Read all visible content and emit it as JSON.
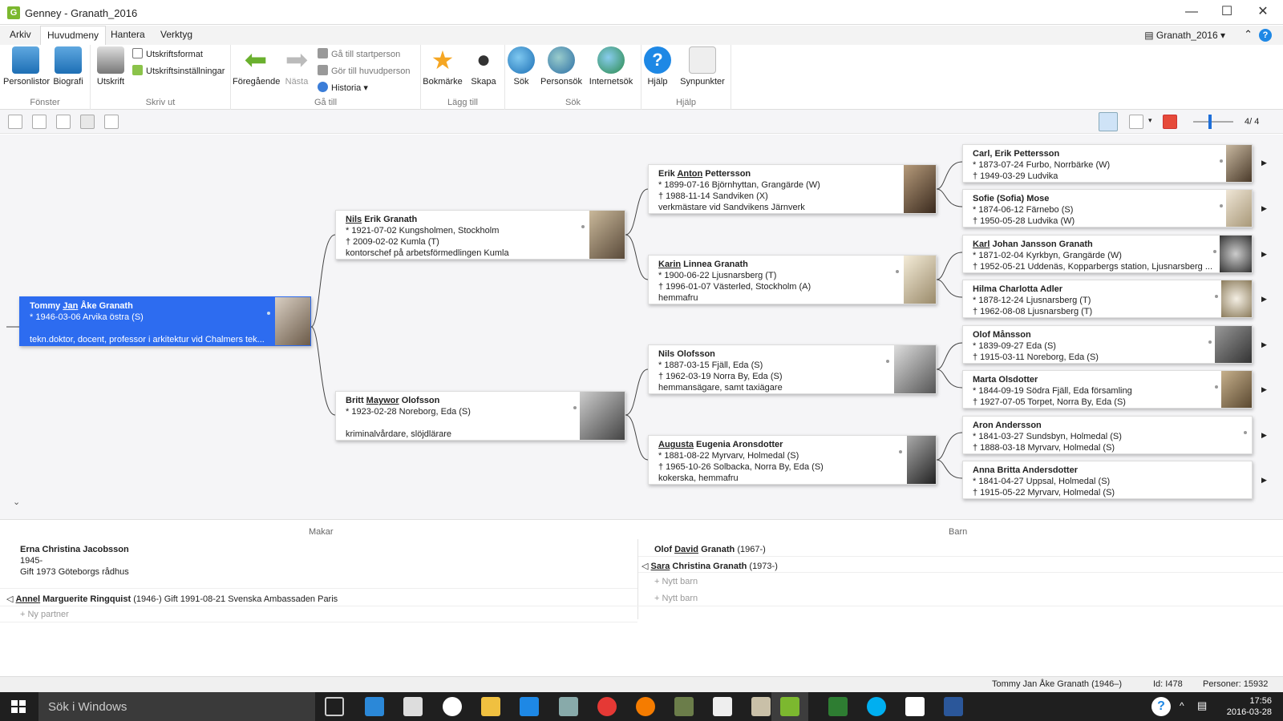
{
  "window": {
    "title": "Genney - Granath_2016",
    "logo": "G"
  },
  "menu": {
    "items": [
      "Arkiv",
      "Huvudmeny",
      "Hantera",
      "Verktyg"
    ],
    "active": "Huvudmeny",
    "project": "Granath_2016"
  },
  "ribbon": {
    "fonster": {
      "label": "Fönster",
      "personlistor": "Personlistor",
      "biografi": "Biografi"
    },
    "skrivut": {
      "label": "Skriv ut",
      "utskrift": "Utskrift",
      "format": "Utskriftsformat",
      "installningar": "Utskriftsinställningar"
    },
    "gatill": {
      "label": "Gå till",
      "foregaende": "Föregående",
      "nasta": "Nästa",
      "startperson": "Gå till startperson",
      "huvudperson": "Gör till huvudperson",
      "historia": "Historia"
    },
    "laggtill": {
      "label": "Lägg till",
      "bokmarke": "Bokmärke",
      "skapa": "Skapa"
    },
    "sok": {
      "label": "Sök",
      "sok": "Sök",
      "personsok": "Personsök",
      "internetsok": "Internetsök"
    },
    "hjalp": {
      "label": "Hjälp",
      "hjalp": "Hjälp",
      "synpunkter": "Synpunkter"
    }
  },
  "toolbar2": {
    "generations": "4/  4"
  },
  "tree": {
    "root": {
      "pre": "Tommy ",
      "u": "Jan",
      "post": " Åke Granath",
      "l1": "* 1946-03-06 Arvika östra (S)",
      "l2": "",
      "l3": "tekn.doktor, docent, professor i arkitektur vid Chalmers tek..."
    },
    "father": {
      "pre": "",
      "u": "Nils",
      "post": " Erik Granath",
      "l1": "* 1921-07-02 Kungsholmen, Stockholm",
      "l2": "† 2009-02-02 Kumla (T)",
      "l3": "kontorschef på arbetsförmedlingen Kumla"
    },
    "mother": {
      "pre": "Britt ",
      "u": "Maywor",
      "post": " Olofsson",
      "l1": "* 1923-02-28 Noreborg, Eda (S)",
      "l2": "",
      "l3": "kriminalvårdare, slöjdlärare"
    },
    "ff": {
      "pre": "Erik ",
      "u": "Anton",
      "post": " Pettersson",
      "l1": "* 1899-07-16 Björnhyttan, Grangärde (W)",
      "l2": "† 1988-11-14 Sandviken (X)",
      "l3": "verkmästare vid Sandvikens Järnverk"
    },
    "fm": {
      "pre": "",
      "u": "Karin",
      "post": " Linnea Granath",
      "l1": "* 1900-06-22 Ljusnarsberg (T)",
      "l2": "† 1996-01-07 Västerled, Stockholm (A)",
      "l3": "hemmafru"
    },
    "mf": {
      "pre": "Nils Olofsson",
      "u": "",
      "post": "",
      "l1": "* 1887-03-15 Fjäll, Eda (S)",
      "l2": "† 1962-03-19 Norra By, Eda (S)",
      "l3": "hemmansägare, samt taxiägare"
    },
    "mm": {
      "pre": "",
      "u": "Augusta",
      "post": " Eugenia Aronsdotter",
      "l1": "* 1881-08-22 Myrvarv, Holmedal (S)",
      "l2": "† 1965-10-26 Solbacka, Norra By, Eda (S)",
      "l3": "kokerska, hemmafru"
    },
    "g1": {
      "pre": "Carl, Erik Pettersson",
      "u": "",
      "post": "",
      "l1": "* 1873-07-24 Furbo, Norrbärke (W)",
      "l2": "† 1949-03-29 Ludvika"
    },
    "g2": {
      "pre": "Sofie (Sofia) Mose",
      "u": "",
      "post": "",
      "l1": "* 1874-06-12 Färnebo (S)",
      "l2": "† 1950-05-28 Ludvika (W)"
    },
    "g3": {
      "pre": "",
      "u": "Karl",
      "post": " Johan Jansson Granath",
      "l1": "* 1871-02-04 Kyrkbyn, Grangärde (W)",
      "l2": "† 1952-05-21 Uddenäs, Kopparbergs station, Ljusnarsberg ..."
    },
    "g4": {
      "pre": "Hilma Charlotta Adler",
      "u": "",
      "post": "",
      "l1": "* 1878-12-24 Ljusnarsberg (T)",
      "l2": "† 1962-08-08 Ljusnarsberg (T)"
    },
    "g5": {
      "pre": "Olof Månsson",
      "u": "",
      "post": "",
      "l1": "* 1839-09-27 Eda (S)",
      "l2": "† 1915-03-11 Noreborg, Eda (S)"
    },
    "g6": {
      "pre": "Marta Olsdotter",
      "u": "",
      "post": "",
      "l1": "* 1844-09-19 Södra Fjäll, Eda församling",
      "l2": "† 1927-07-05 Torpet, Norra By, Eda (S)"
    },
    "g7": {
      "pre": "Aron Andersson",
      "u": "",
      "post": "",
      "l1": "* 1841-03-27 Sundsbyn, Holmedal (S)",
      "l2": "† 1888-03-18 Myrvarv, Holmedal (S)"
    },
    "g8": {
      "pre": "Anna Britta Andersdotter",
      "u": "",
      "post": "",
      "l1": "* 1841-04-27 Uppsal, Holmedal (S)",
      "l2": "† 1915-05-22 Myrvarv, Holmedal (S)"
    }
  },
  "lower": {
    "makar_label": "Makar",
    "barn_label": "Barn",
    "spouse1": {
      "name": "Erna Christina Jacobsson",
      "years": "1945-",
      "married": "Gift 1973 Göteborgs rådhus"
    },
    "spouse2": {
      "u": "Annel",
      "name": " Marguerite Ringquist",
      "rest": " (1946-) Gift 1991-08-21 Svenska Ambassaden Paris"
    },
    "new_partner": "+ Ny partner",
    "child1": {
      "pre": "Olof ",
      "u": "David",
      "post": " Granath",
      "years": " (1967-)"
    },
    "child2": {
      "pre": "",
      "u": "Sara",
      "post": " Christina Granath",
      "years": " (1973-)"
    },
    "new_child": "+ Nytt barn"
  },
  "status": {
    "person": "Tommy Jan Åke Granath (1946–)",
    "id": "Id: I478",
    "count": "Personer: 15932"
  },
  "taskbar": {
    "search": "Sök i Windows",
    "time": "17:56",
    "date": "2016-03-28"
  }
}
